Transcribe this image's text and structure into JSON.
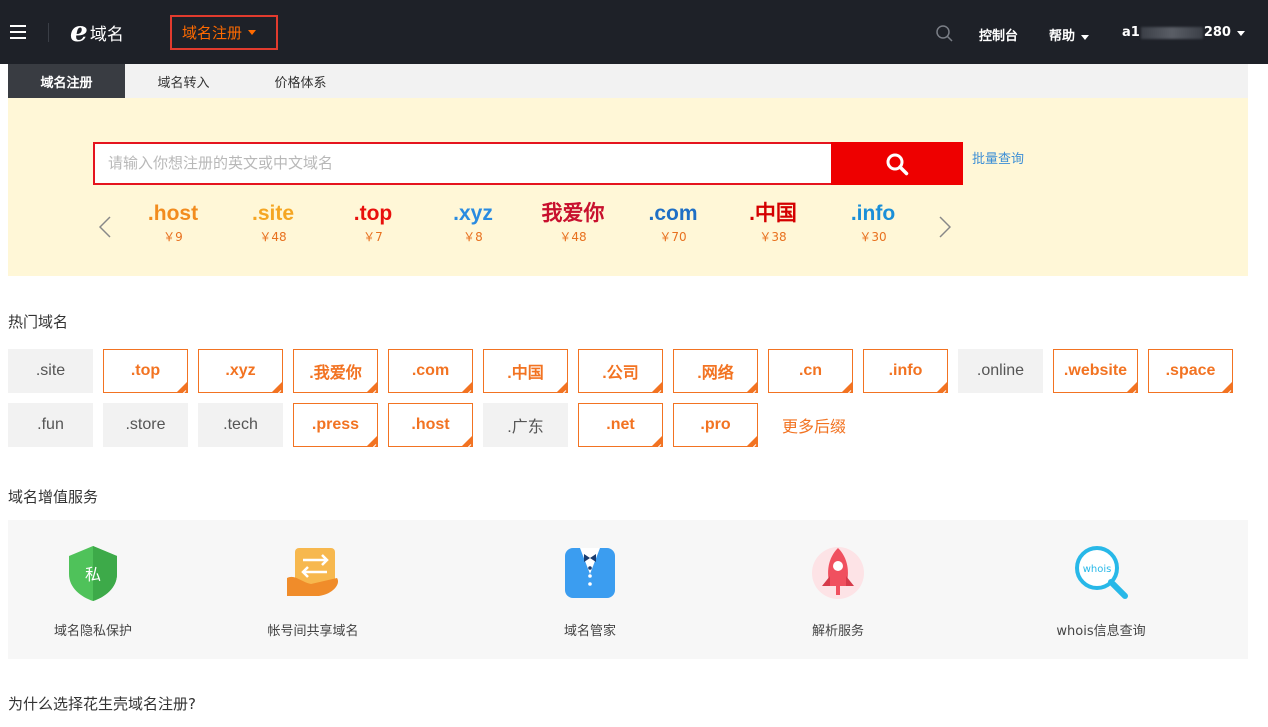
{
  "nav": {
    "logo_text": "域名",
    "domain_menu_label": "域名注册",
    "console_label": "控制台",
    "help_label": "帮助",
    "account_prefix": "a1",
    "account_suffix": "280"
  },
  "tabs": [
    {
      "label": "域名注册",
      "active": true
    },
    {
      "label": "域名转入",
      "active": false
    },
    {
      "label": "价格体系",
      "active": false
    }
  ],
  "search": {
    "placeholder": "请输入你想注册的英文或中文域名",
    "value": "",
    "batch_link": "批量查询"
  },
  "featured_tlds": [
    {
      "name": ".host",
      "price": "￥9",
      "color": "#f28c1e"
    },
    {
      "name": ".site",
      "price": "￥48",
      "color": "#f5a623"
    },
    {
      "name": ".top",
      "price": "￥7",
      "color": "#e8100c"
    },
    {
      "name": ".xyz",
      "price": "￥8",
      "color": "#2a8be0"
    },
    {
      "name": "我爱你",
      "price": "￥48",
      "color": "#c8102e"
    },
    {
      "name": ".com",
      "price": "￥70",
      "color": "#1f6fc5"
    },
    {
      "name": ".中国",
      "price": "￥38",
      "color": "#d40000"
    },
    {
      "name": ".info",
      "price": "￥30",
      "color": "#1a8fd8"
    }
  ],
  "hot_section_title": "热门域名",
  "hot_domains": [
    {
      "label": ".site",
      "highlight": false
    },
    {
      "label": ".top",
      "highlight": true
    },
    {
      "label": ".xyz",
      "highlight": true
    },
    {
      "label": ".我爱你",
      "highlight": true
    },
    {
      "label": ".com",
      "highlight": true
    },
    {
      "label": ".中国",
      "highlight": true
    },
    {
      "label": ".公司",
      "highlight": true
    },
    {
      "label": ".网络",
      "highlight": true
    },
    {
      "label": ".cn",
      "highlight": true
    },
    {
      "label": ".info",
      "highlight": true
    },
    {
      "label": ".online",
      "highlight": false
    },
    {
      "label": ".website",
      "highlight": true
    },
    {
      "label": ".space",
      "highlight": true
    },
    {
      "label": ".fun",
      "highlight": false
    },
    {
      "label": ".store",
      "highlight": false
    },
    {
      "label": ".tech",
      "highlight": false
    },
    {
      "label": ".press",
      "highlight": true
    },
    {
      "label": ".host",
      "highlight": true
    },
    {
      "label": ".广东",
      "highlight": false
    },
    {
      "label": ".net",
      "highlight": true
    },
    {
      "label": ".pro",
      "highlight": true
    }
  ],
  "more_suffix_label": "更多后缀",
  "services_title": "域名增值服务",
  "services": [
    {
      "label": "域名隐私保护",
      "icon": "privacy-shield-icon",
      "badge": "私"
    },
    {
      "label": "帐号间共享域名",
      "icon": "share-domain-icon"
    },
    {
      "label": "域名管家",
      "icon": "domain-butler-icon"
    },
    {
      "label": "解析服务",
      "icon": "dns-rocket-icon"
    },
    {
      "label": "whois信息查询",
      "icon": "whois-search-icon",
      "badge": "whois"
    }
  ],
  "why_title": "为什么选择花生壳域名注册?",
  "colors": {
    "accent_orange": "#f27322",
    "search_red": "#ee0000",
    "nav_bg": "#1e2128",
    "banner_bg": "#fff7d7",
    "link_blue": "#3d8fd6"
  }
}
